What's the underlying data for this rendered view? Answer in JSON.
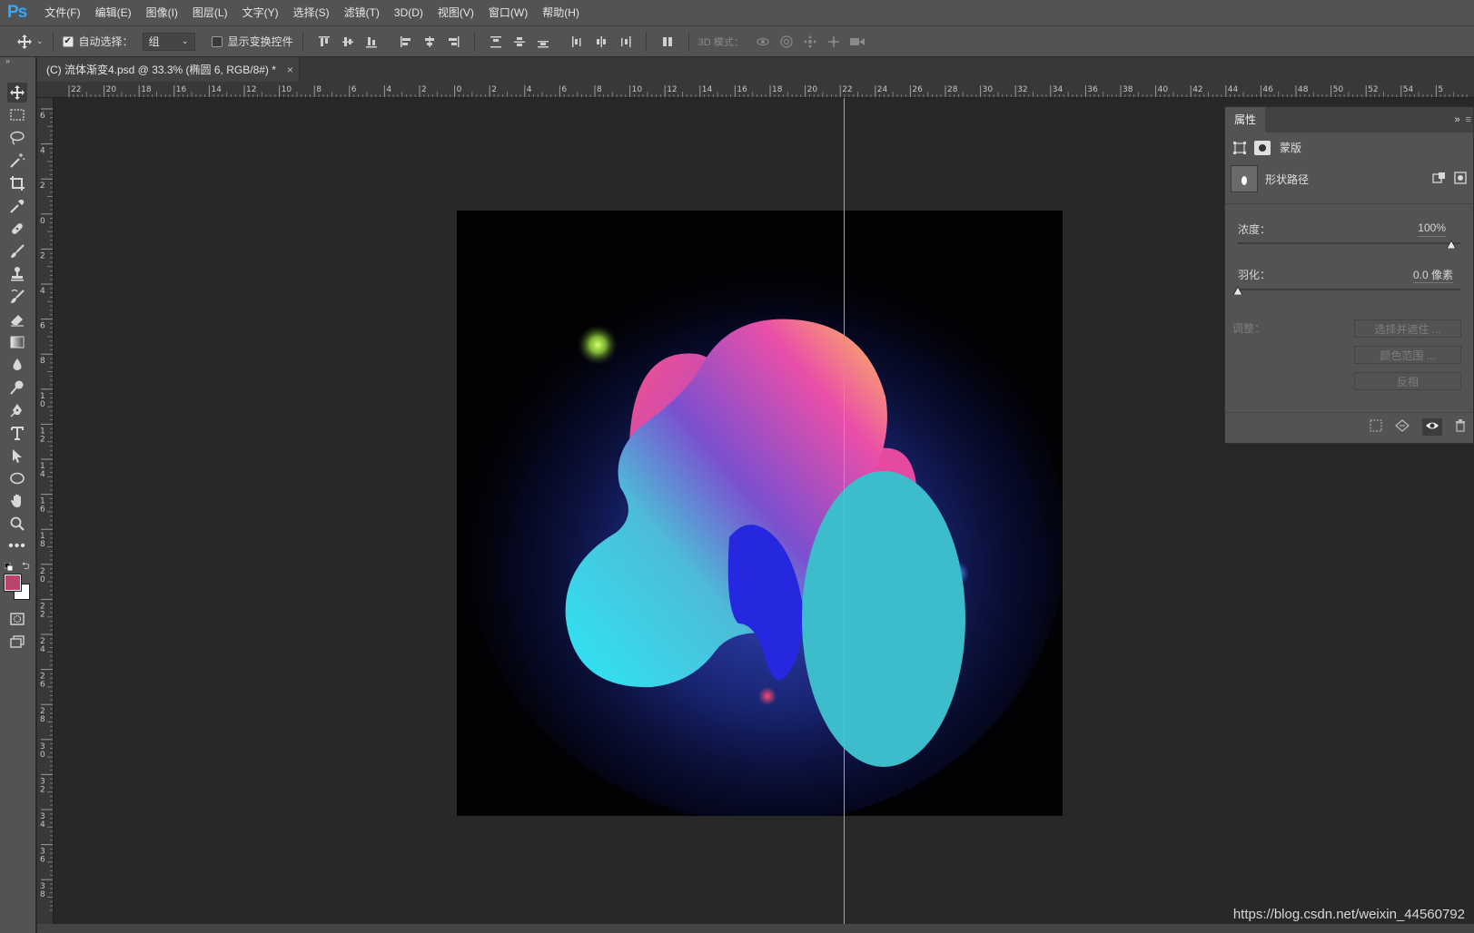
{
  "app": {
    "logo": "Ps"
  },
  "menubar": {
    "items": [
      "文件(F)",
      "编辑(E)",
      "图像(I)",
      "图层(L)",
      "文字(Y)",
      "选择(S)",
      "滤镜(T)",
      "3D(D)",
      "视图(V)",
      "窗口(W)",
      "帮助(H)"
    ]
  },
  "options": {
    "auto_select_label": "自动选择：",
    "auto_select_checked": true,
    "auto_select_value": "组",
    "show_transform_label": "显示变换控件",
    "show_transform_checked": false,
    "mode3d_label": "3D 模式："
  },
  "document": {
    "tab_title": "(C) 流体渐变4.psd @ 33.3% (椭圆 6, RGB/8#) *",
    "close_glyph": "×"
  },
  "rulers": {
    "horizontal_ticks": [
      "22",
      "20",
      "18",
      "16",
      "14",
      "12",
      "10",
      "8",
      "6",
      "4",
      "2",
      "0",
      "2",
      "4",
      "6",
      "8",
      "10",
      "12",
      "14",
      "16",
      "18",
      "20",
      "22",
      "24",
      "26",
      "28",
      "30",
      "32",
      "34",
      "36",
      "38",
      "40",
      "42",
      "44",
      "46",
      "48",
      "50",
      "52",
      "54",
      "5"
    ],
    "vertical_ticks": [
      "6",
      "4",
      "2",
      "0",
      "2",
      "4",
      "6",
      "8",
      "10",
      "12",
      "14",
      "16",
      "18",
      "20",
      "22",
      "24",
      "26",
      "28",
      "30",
      "32",
      "34",
      "36",
      "38"
    ]
  },
  "properties": {
    "tab_label": "属性",
    "mask_label": "蒙版",
    "shape_path_label": "形状路径",
    "density_label": "浓度：",
    "density_value": "100%",
    "density_fraction": 1.0,
    "feather_label": "羽化：",
    "feather_value": "0.0 像素",
    "feather_fraction": 0.0,
    "adjust_label": "调整：",
    "select_mask_button": "选择并遮住 ...",
    "color_range_button": "颜色范围 ...",
    "invert_button": "反相"
  },
  "colors": {
    "foreground": "#b9446c",
    "background": "#ffffff",
    "guide": "#35d0d4",
    "ellipse": "#3dbccc"
  },
  "watermark": "https://blog.csdn.net/weixin_44560792"
}
